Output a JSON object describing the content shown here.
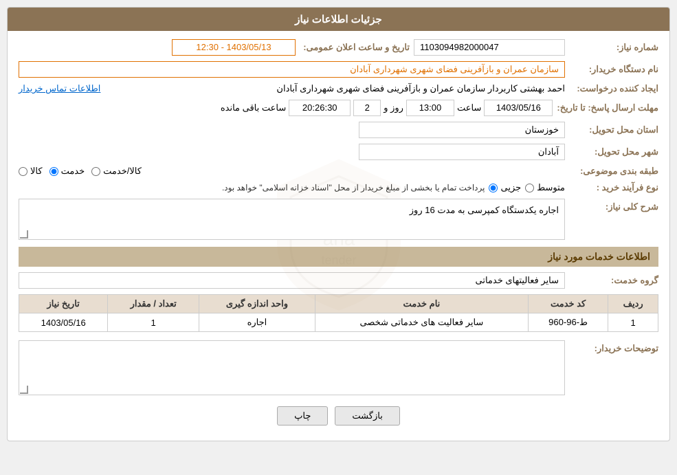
{
  "header": {
    "title": "جزئیات اطلاعات نیاز"
  },
  "fields": {
    "shomareNiaz_label": "شماره نیاز:",
    "shomareNiaz_value": "1103094982000047",
    "namDastgah_label": "نام دستگاه خریدار:",
    "namDastgah_value": "سازمان عمران و بازآفرینی فضای شهری شهرداری آبادان",
    "tarikh_label": "تاریخ و ساعت اعلان عمومی:",
    "tarikh_value": "1403/05/13 - 12:30",
    "ijadKonande_label": "ایجاد کننده درخواست:",
    "ijadKonande_value": "احمد بهشتی کاربردار سازمان عمران و بازآفرینی فضای شهری شهرداری آبادان",
    "ettelaat_link": "اطلاعات تماس خریدار",
    "mohlatErsal_label": "مهلت ارسال پاسخ: تا تاریخ:",
    "ersal_date": "1403/05/16",
    "ersal_saat_label": "ساعت",
    "ersal_saat": "13:00",
    "ersal_roz_label": "روز و",
    "ersal_roz": "2",
    "mande_label": "ساعت باقی مانده",
    "mande_value": "20:26:30",
    "ostan_label": "استان محل تحویل:",
    "ostan_value": "خوزستان",
    "shahr_label": "شهر محل تحویل:",
    "shahr_value": "آبادان",
    "tabaqe_label": "طبقه بندی موضوعی:",
    "tabaqe_kala": "کالا",
    "tabaqe_khadamat": "خدمت",
    "tabaqe_kala_khadamat": "کالا/خدمت",
    "tabaqe_selected": "khadamat",
    "noeFarayand_label": "نوع فرآیند خرید :",
    "noeFarayand_jozi": "جزیی",
    "noeFarayand_motavasset": "متوسط",
    "noeFarayand_selected": "jozi",
    "farayand_text": "پرداخت تمام یا بخشی از مبلغ خریدار از محل \"اسناد خزانه اسلامی\" خواهد بود.",
    "sharhSection": "شرح کلی نیاز:",
    "sharh_value": "اجاره یکدستگاه کمپرسی به مدت 16 روز",
    "khadamatSection": "اطلاعات خدمات مورد نیاز",
    "groheKhadamat_label": "گروه خدمت:",
    "groheKhadamat_value": "سایر فعالیتهای خدماتی",
    "table": {
      "headers": [
        "ردیف",
        "کد خدمت",
        "نام خدمت",
        "واحد اندازه گیری",
        "تعداد / مقدار",
        "تاریخ نیاز"
      ],
      "rows": [
        {
          "radif": "1",
          "kodKhadamat": "ط-96-960",
          "namKhadamat": "سایر فعالیت های خدماتی شخصی",
          "vahed": "اجاره",
          "tedad": "1",
          "tarikh": "1403/05/16"
        }
      ]
    },
    "tawzih_label": "توضیحات خریدار:",
    "tawzih_value": ""
  },
  "buttons": {
    "print": "چاپ",
    "back": "بازگشت"
  }
}
